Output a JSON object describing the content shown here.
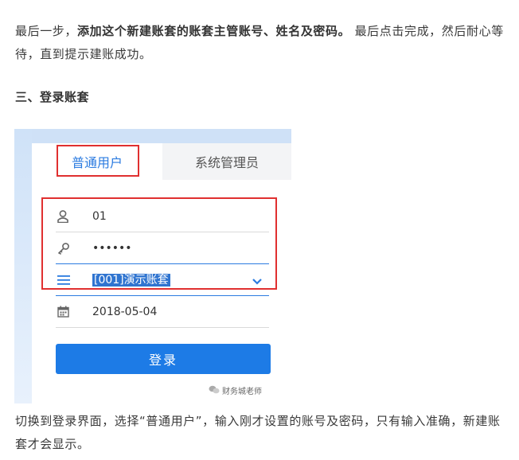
{
  "article": {
    "intro_lead": "最后一步，",
    "intro_bold": "添加这个新建账套的账套主管账号、姓名及密码。",
    "intro_tail": " 最后点击完成，然后耐心等待，直到提示建账成功。",
    "section_heading": "三、登录账套",
    "closing": "切换到登录界面，选择“普通用户”，输入刚才设置的账号及密码，只有输入准确，新建账套才会显示。"
  },
  "login": {
    "tabs": {
      "normal_user": "普通用户",
      "system_admin": "系统管理员"
    },
    "account_value": "01",
    "password_value": "••••••",
    "ledger_value": "[001]演示账套",
    "date_value": "2018-05-04",
    "login_button": "登录",
    "watermark": "财务城老师"
  },
  "colors": {
    "accent": "#1d7be6",
    "highlight_box": "#e03030"
  }
}
